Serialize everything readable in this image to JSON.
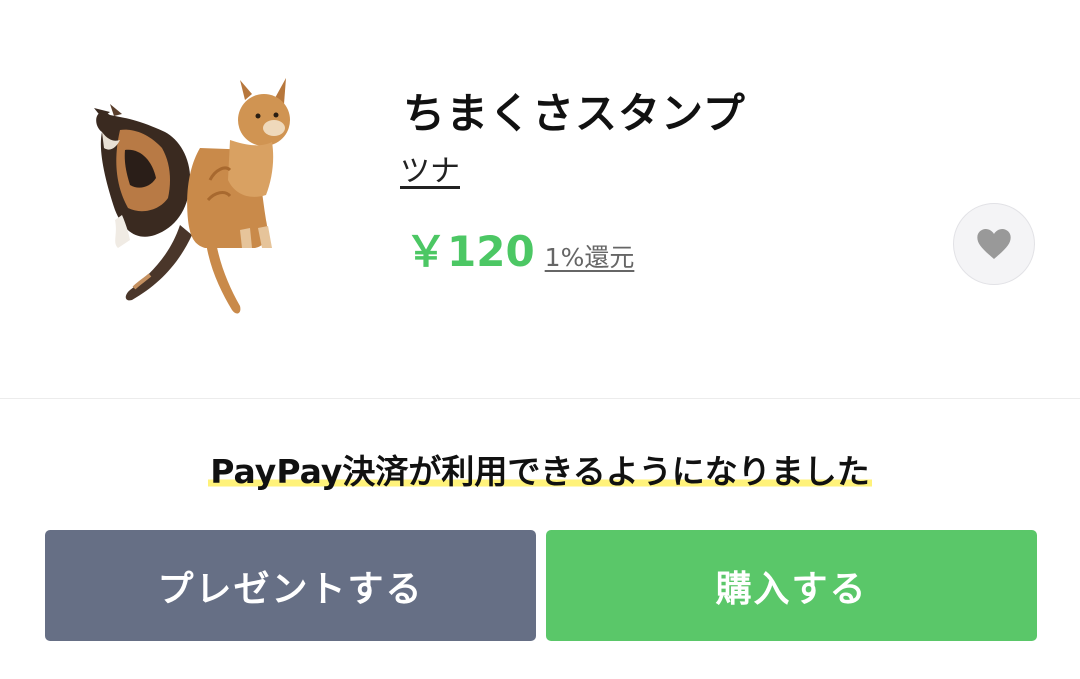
{
  "product": {
    "title": "ちまくさスタンプ",
    "author": "ツナ",
    "price": "￥120",
    "cashback": "1%還元",
    "favorite_icon": "heart-icon",
    "thumbnail": "two-cats-sticker"
  },
  "notice": {
    "text": "PayPay決済が利用できるようになりました"
  },
  "actions": {
    "present_label": "プレゼントする",
    "buy_label": "購入する"
  },
  "colors": {
    "price": "#4cc764",
    "present_button": "#666f85",
    "buy_button": "#5ac769",
    "highlight": "#fff27a"
  }
}
